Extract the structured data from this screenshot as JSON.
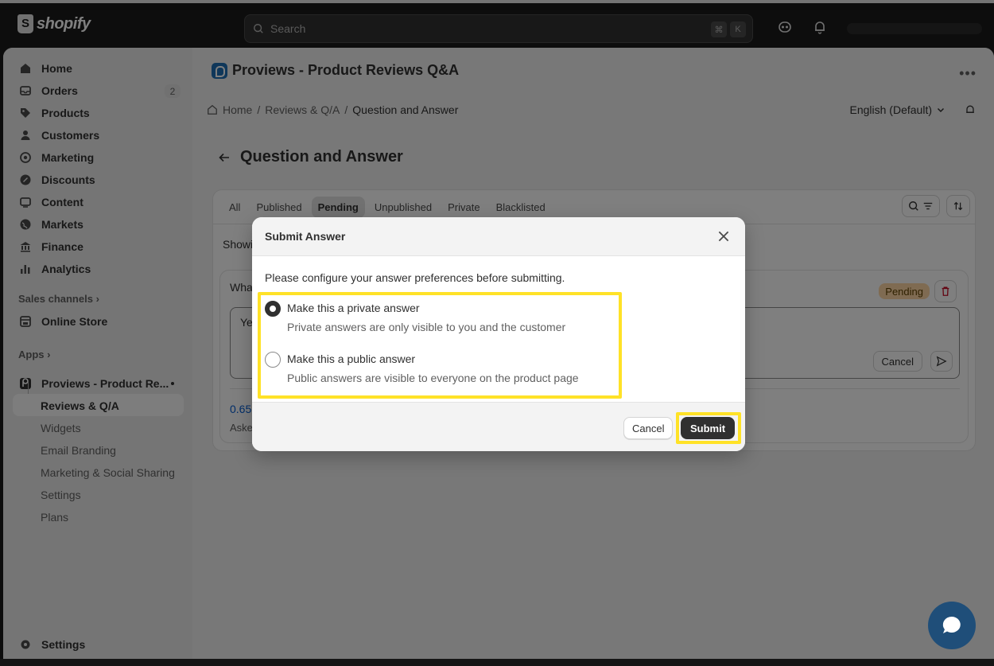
{
  "topbar": {
    "brand": "shopify",
    "search_placeholder": "Search",
    "shortcut_key1": "⌘",
    "shortcut_key2": "K"
  },
  "sidebar": {
    "items": [
      {
        "label": "Home",
        "icon": "home-icon"
      },
      {
        "label": "Orders",
        "icon": "inbox-icon",
        "badge": "2"
      },
      {
        "label": "Products",
        "icon": "tag-icon"
      },
      {
        "label": "Customers",
        "icon": "person-icon"
      },
      {
        "label": "Marketing",
        "icon": "target-icon"
      },
      {
        "label": "Discounts",
        "icon": "discount-icon"
      },
      {
        "label": "Content",
        "icon": "content-icon"
      },
      {
        "label": "Markets",
        "icon": "globe-icon"
      },
      {
        "label": "Finance",
        "icon": "bank-icon"
      },
      {
        "label": "Analytics",
        "icon": "chart-bar-icon"
      }
    ],
    "sales_channels_label": "Sales channels",
    "online_store_label": "Online Store",
    "apps_label": "Apps",
    "app_name": "Proviews - Product Re...",
    "app_subitems": [
      "Reviews & Q/A",
      "Widgets",
      "Email Branding",
      "Marketing & Social Sharing",
      "Settings",
      "Plans"
    ],
    "settings_label": "Settings"
  },
  "main": {
    "app_title": "Proviews - Product Reviews Q&A",
    "breadcrumb": [
      "Home",
      "/",
      "Reviews & Q/A",
      "/",
      "Question and Answer"
    ],
    "language": "English (Default)",
    "page_title": "Question and Answer",
    "tabs": [
      "All",
      "Published",
      "Pending",
      "Unpublished",
      "Private",
      "Blacklisted"
    ],
    "selected_tab": "Pending",
    "showing_text": "Showi",
    "question_text": "Wha",
    "status_badge": "Pending",
    "answer_text": "Ye",
    "cancel_label": "Cancel",
    "rating_text": "0.65",
    "asked_text": "Aske"
  },
  "modal": {
    "title": "Submit Answer",
    "intro": "Please configure your answer preferences before submitting.",
    "options": [
      {
        "label": "Make this a private answer",
        "help": "Private answers are only visible to you and the customer",
        "selected": true
      },
      {
        "label": "Make this a public answer",
        "help": "Public answers are visible to everyone on the product page",
        "selected": false
      }
    ],
    "cancel_label": "Cancel",
    "submit_label": "Submit"
  },
  "colors": {
    "highlight": "#ffe227",
    "primary_button": "#303030",
    "badge_pending": "#ffd6a4"
  }
}
